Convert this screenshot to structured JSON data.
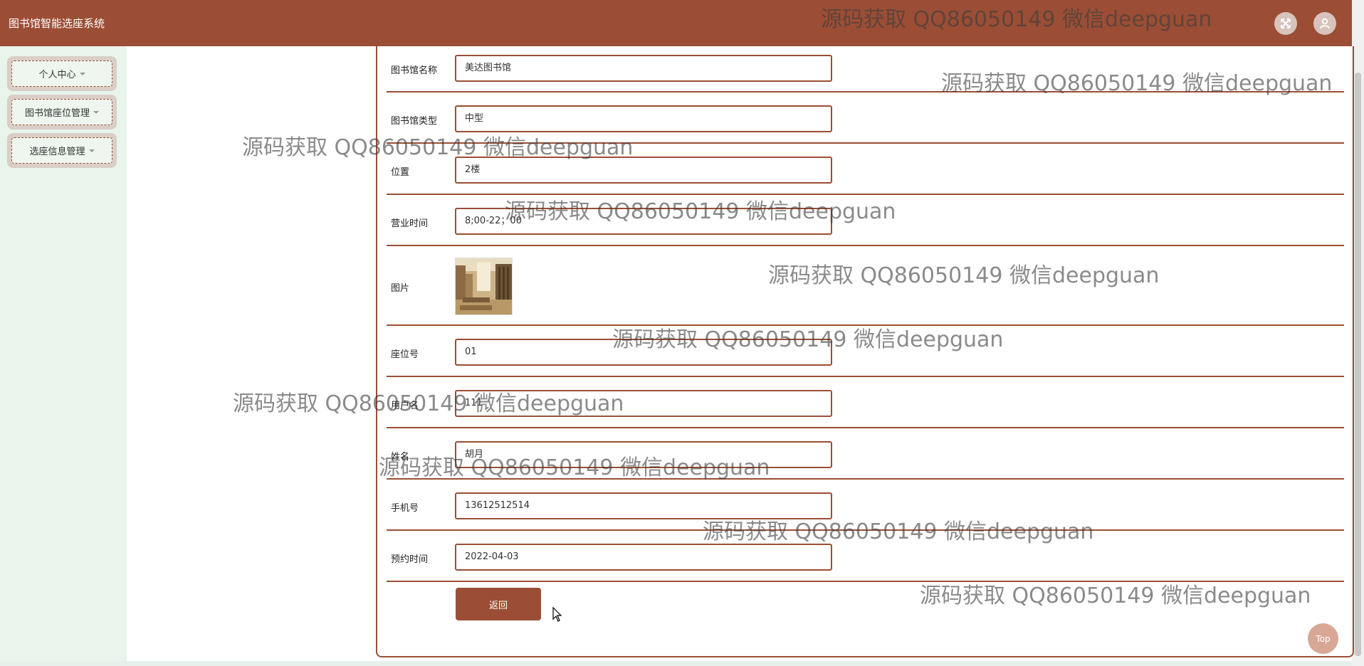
{
  "app": {
    "title": "图书馆智能选座系统"
  },
  "header": {
    "fullscreen_icon": "fullscreen-icon",
    "avatar_icon": "user-icon"
  },
  "sidebar": {
    "items": [
      {
        "label": "个人中心"
      },
      {
        "label": "图书馆座位管理"
      },
      {
        "label": "选座信息管理"
      }
    ]
  },
  "form": {
    "fields": [
      {
        "label": "图书馆名称",
        "value": "美达图书馆"
      },
      {
        "label": "图书馆类型",
        "value": "中型"
      },
      {
        "label": "位置",
        "value": "2楼"
      },
      {
        "label": "营业时间",
        "value": "8;00-22；00"
      },
      {
        "label": "图片"
      },
      {
        "label": "座位号",
        "value": "01"
      },
      {
        "label": "用户名",
        "value": "111"
      },
      {
        "label": "姓名",
        "value": "胡月"
      },
      {
        "label": "手机号",
        "value": "13612512514"
      },
      {
        "label": "预约时间",
        "value": "2022-04-03"
      }
    ],
    "back_label": "返回"
  },
  "top_button": {
    "label": "Top"
  },
  "watermark": {
    "text": "源码获取 QQ86050149 微信deepguan"
  },
  "colors": {
    "primary": "#9b4e35",
    "sidebar_bg": "#e8f4ec",
    "sidebar_btn_bg": "#d9cfc7",
    "top_button": "#d8a796"
  }
}
